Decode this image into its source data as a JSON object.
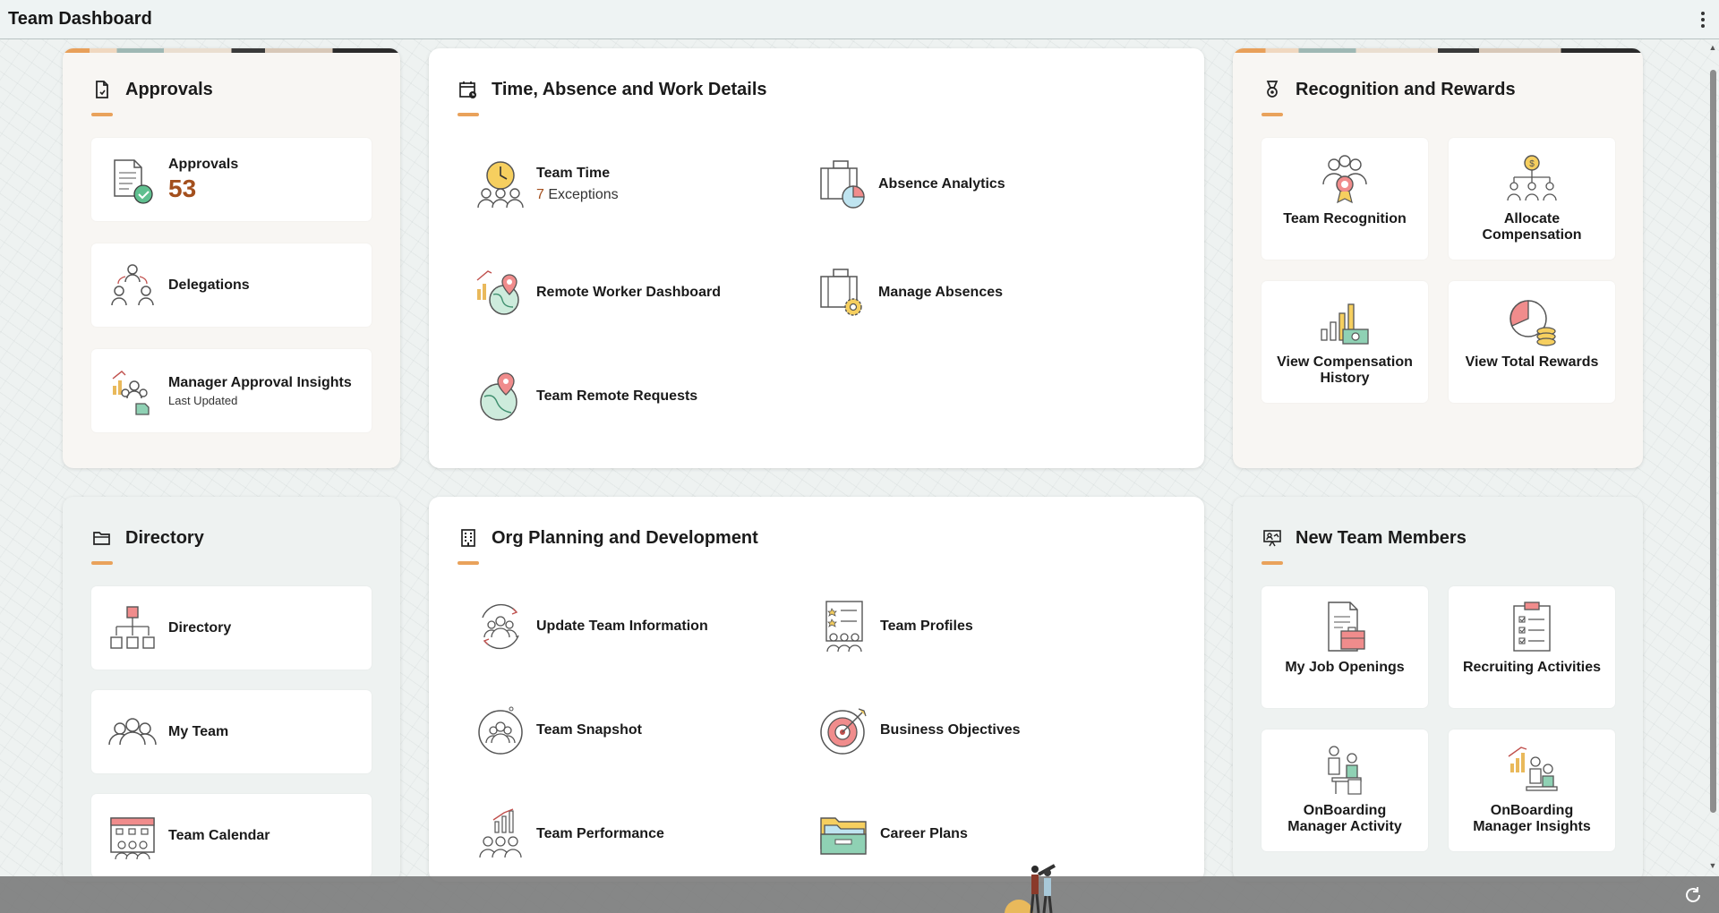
{
  "header": {
    "title": "Team Dashboard"
  },
  "colors": {
    "accent": "#e9a25b",
    "count": "#a34f1d"
  },
  "approvals_panel": {
    "title": "Approvals",
    "tiles": [
      {
        "label": "Approvals",
        "count": "53"
      },
      {
        "label": "Delegations"
      },
      {
        "label": "Manager Approval Insights",
        "sub": "Last Updated"
      }
    ]
  },
  "time_panel": {
    "title": "Time, Absence and Work Details",
    "team_time": {
      "label": "Team Time",
      "count": "7",
      "count_label": "Exceptions"
    },
    "absence_analytics": "Absence Analytics",
    "remote_worker": "Remote Worker Dashboard",
    "manage_absences": "Manage Absences",
    "remote_requests": "Team Remote Requests"
  },
  "rewards_panel": {
    "title": "Recognition and Rewards",
    "tiles": [
      "Team Recognition",
      "Allocate Compensation",
      "View Compensation History",
      "View Total Rewards"
    ]
  },
  "directory_panel": {
    "title": "Directory",
    "tiles": [
      "Directory",
      "My Team",
      "Team Calendar"
    ]
  },
  "org_panel": {
    "title": "Org Planning and Development",
    "links": [
      "Update Team Information",
      "Team Profiles",
      "Team Snapshot",
      "Business Objectives",
      "Team Performance",
      "Career Plans"
    ]
  },
  "new_members_panel": {
    "title": "New Team Members",
    "tiles": [
      "My Job Openings",
      "Recruiting Activities",
      "OnBoarding Manager Activity",
      "OnBoarding Manager Insights"
    ]
  }
}
